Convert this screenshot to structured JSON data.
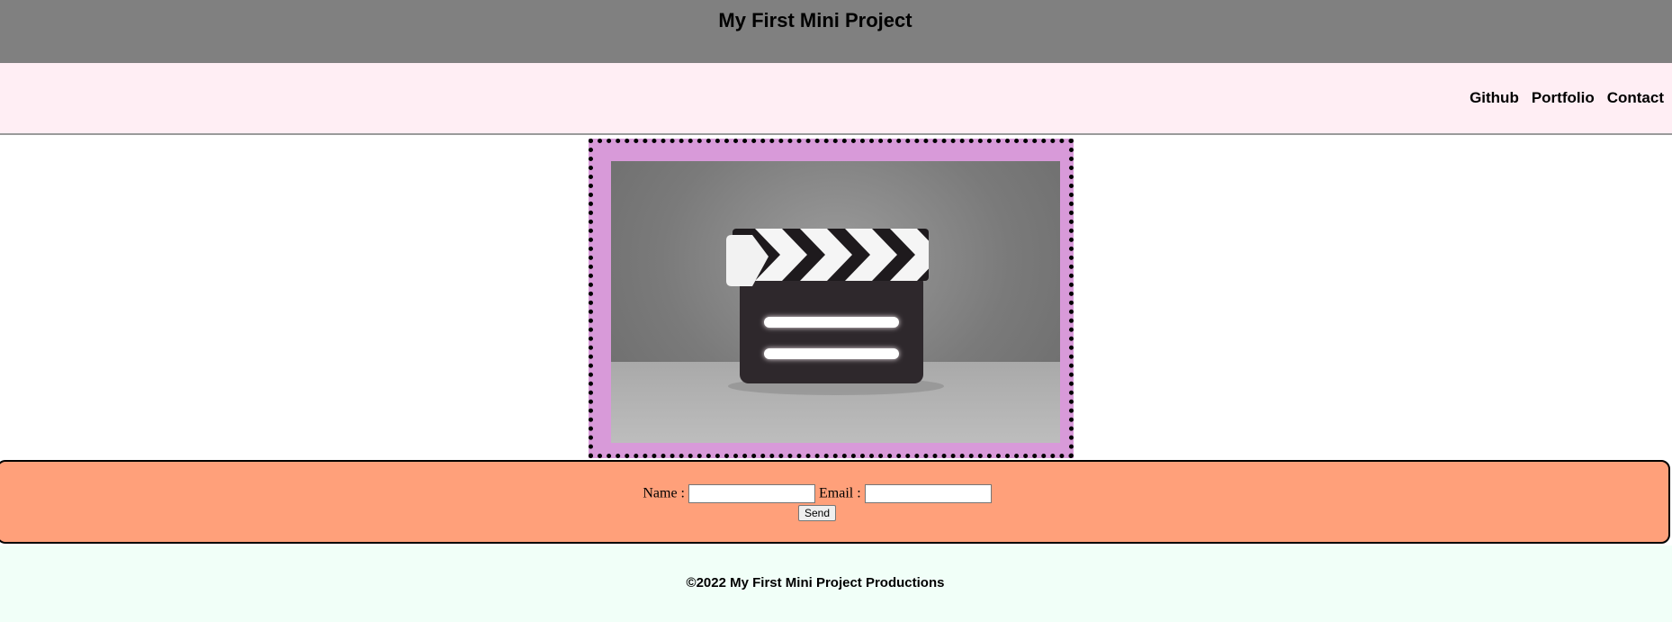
{
  "header": {
    "title": "My First Mini Project"
  },
  "nav": {
    "links": [
      "Github",
      "Portfolio",
      "Contact"
    ]
  },
  "hero": {
    "image_icon": "clapperboard-icon",
    "frame_color": "#d89ad9"
  },
  "contact_form": {
    "name_label": "Name :",
    "email_label": "Email :",
    "name_value": "",
    "email_value": "",
    "send_label": "Send",
    "background_color": "#ffa07a"
  },
  "footer": {
    "text": "©2022 My First Mini Project Productions"
  },
  "colors": {
    "header_bg": "#808080",
    "nav_bg": "#ffeef4",
    "footer_bg": "#f1fff8"
  }
}
